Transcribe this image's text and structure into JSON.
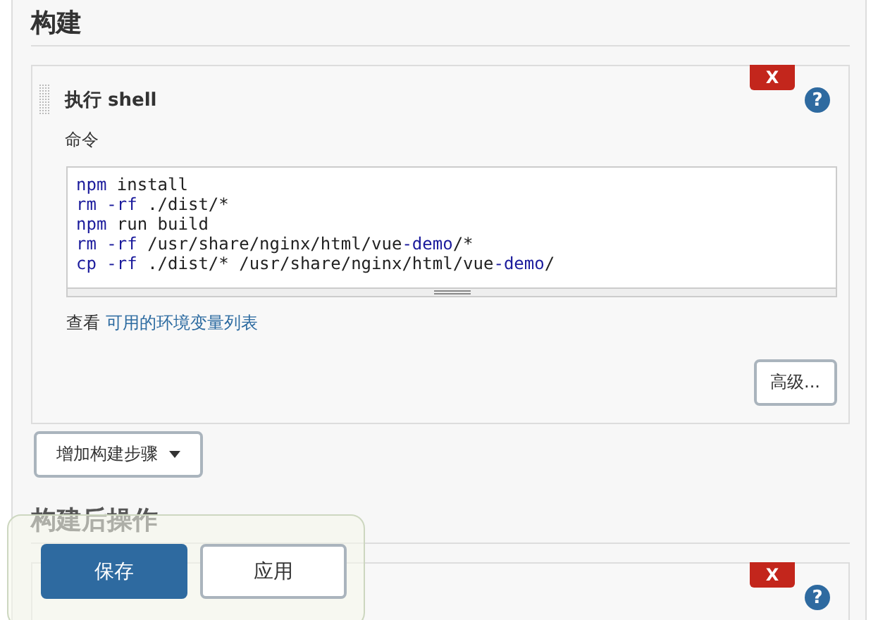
{
  "sections": [
    {
      "heading": "构建",
      "steps": [
        {
          "title": "执行 shell",
          "delete_label": "X",
          "help": "?",
          "field_label": "命令",
          "code": [
            [
              {
                "text": "npm",
                "kind": "keyword"
              },
              {
                "text": " install",
                "kind": "plain"
              }
            ],
            [
              {
                "text": "rm -rf",
                "kind": "keyword"
              },
              {
                "text": " ./dist/*",
                "kind": "plain"
              }
            ],
            [
              {
                "text": "npm",
                "kind": "keyword"
              },
              {
                "text": " run build",
                "kind": "plain"
              }
            ],
            [
              {
                "text": "rm -rf",
                "kind": "keyword"
              },
              {
                "text": " /usr/share/nginx/html/vue",
                "kind": "plain"
              },
              {
                "text": "-demo",
                "kind": "keyword"
              },
              {
                "text": "/*",
                "kind": "plain"
              }
            ],
            [
              {
                "text": "cp -rf",
                "kind": "keyword"
              },
              {
                "text": " ./dist/* /usr/share/nginx/html/vue",
                "kind": "plain"
              },
              {
                "text": "-demo",
                "kind": "keyword"
              },
              {
                "text": "/",
                "kind": "plain"
              }
            ]
          ],
          "hint_prefix": "查看",
          "hint_link": "可用的环境变量列表",
          "advanced_button": "高级..."
        }
      ],
      "add_button": "增加构建步骤"
    },
    {
      "heading": "构建后操作",
      "steps": [
        {
          "delete_label": "X",
          "help": "?"
        }
      ]
    }
  ],
  "footer": {
    "buttons": [
      {
        "label": "保存",
        "kind": "primary"
      },
      {
        "label": "应用",
        "kind": "secondary"
      }
    ]
  }
}
